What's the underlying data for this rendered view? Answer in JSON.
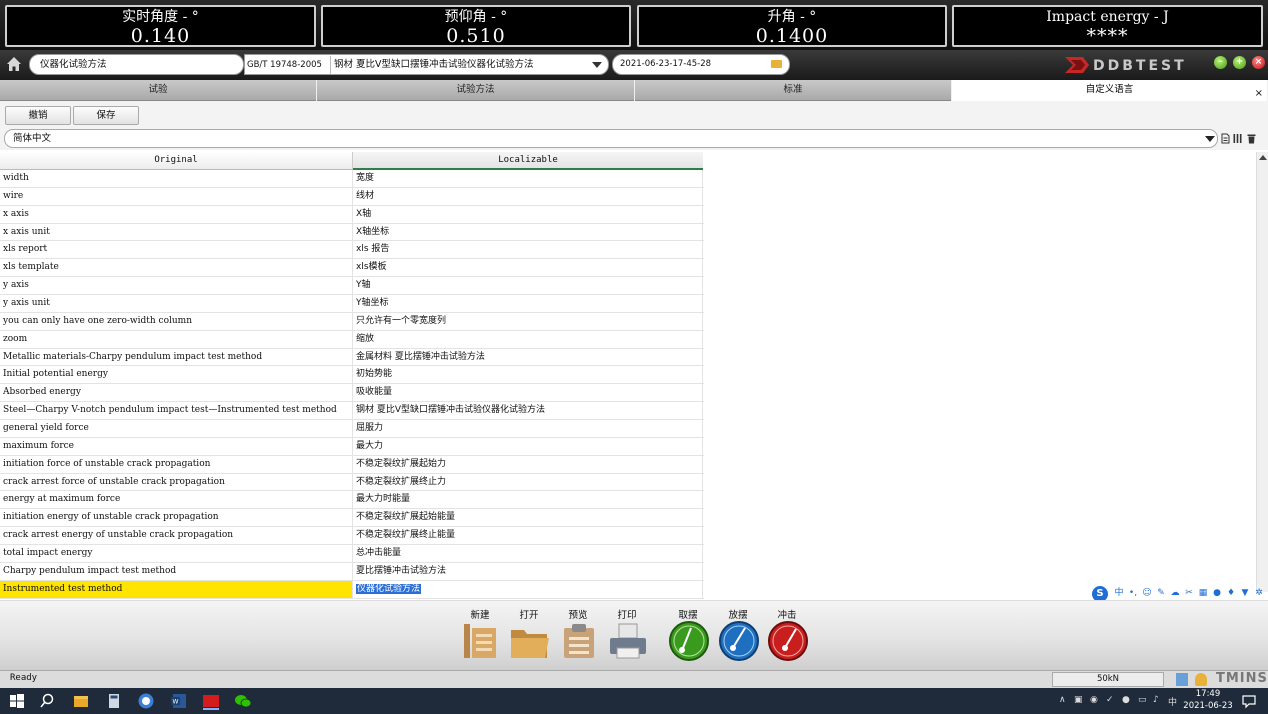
{
  "readouts": [
    {
      "label": "实时角度 - °",
      "value": "0.140"
    },
    {
      "label": "预仰角 - °",
      "value": "0.510"
    },
    {
      "label": "升角 - °",
      "value": "0.1400"
    },
    {
      "label": "Impact energy - J",
      "value": "****"
    }
  ],
  "toolbar": {
    "method_name": "仪器化试验方法",
    "standard_code": "GB/T 19748-2005",
    "standard_name": "钢材 夏比V型缺口摆锤冲击试验仪器化试验方法",
    "date": "2021-06-23-17-45-28",
    "logo_text": "DDBTEST",
    "window_buttons": [
      "–",
      "+",
      "×"
    ]
  },
  "tabs": [
    {
      "label": "试验",
      "active": false
    },
    {
      "label": "试验方法",
      "active": false
    },
    {
      "label": "标准",
      "active": false
    },
    {
      "label": "自定义语言",
      "active": true
    }
  ],
  "tab_close": "×",
  "actions": {
    "undo": "撤销",
    "save": "保存"
  },
  "language": {
    "selected": "简体中文"
  },
  "table": {
    "headers": {
      "original": "Original",
      "localizable": "Localizable"
    },
    "rows": [
      {
        "original": "width",
        "localizable": "宽度"
      },
      {
        "original": "wire",
        "localizable": "线材"
      },
      {
        "original": "x axis",
        "localizable": "X轴"
      },
      {
        "original": "x axis unit",
        "localizable": "X轴坐标"
      },
      {
        "original": "xls report",
        "localizable": "xls 报告"
      },
      {
        "original": "xls template",
        "localizable": "xls模板"
      },
      {
        "original": "y axis",
        "localizable": "Y轴"
      },
      {
        "original": "y axis unit",
        "localizable": "Y轴坐标"
      },
      {
        "original": "you can only have one zero-width column",
        "localizable": "只允许有一个零宽度列"
      },
      {
        "original": "zoom",
        "localizable": "缩放"
      },
      {
        "original": "Metallic materials-Charpy pendulum impact test method",
        "localizable": "金属材料 夏比摆锤冲击试验方法"
      },
      {
        "original": "Initial potential energy",
        "localizable": "初始势能"
      },
      {
        "original": "Absorbed energy",
        "localizable": "吸收能量"
      },
      {
        "original": "Steel—Charpy V-notch pendulum impact test—Instrumented test method",
        "localizable": "钢材 夏比V型缺口摆锤冲击试验仪器化试验方法"
      },
      {
        "original": "general yield force",
        "localizable": "屈服力"
      },
      {
        "original": "maximum force",
        "localizable": "最大力"
      },
      {
        "original": "initiation force of unstable crack propagation",
        "localizable": "不稳定裂纹扩展起始力"
      },
      {
        "original": "crack arrest force of unstable crack propagation",
        "localizable": "不稳定裂纹扩展终止力"
      },
      {
        "original": "energy at maximum force",
        "localizable": "最大力时能量"
      },
      {
        "original": "initiation energy of unstable crack propagation",
        "localizable": "不稳定裂纹扩展起始能量"
      },
      {
        "original": "crack arrest energy of unstable crack propagation",
        "localizable": "不稳定裂纹扩展终止能量"
      },
      {
        "original": "total impact energy",
        "localizable": "总冲击能量"
      },
      {
        "original": "Charpy pendulum impact test method",
        "localizable": "夏比摆锤冲击试验方法"
      },
      {
        "original": "Instrumented test method",
        "localizable": "仪器化试验方法",
        "selected": true
      }
    ]
  },
  "bottom_toolbar": [
    {
      "label": "新建",
      "icon": "new-document-icon"
    },
    {
      "label": "打开",
      "icon": "open-folder-icon"
    },
    {
      "label": "预览",
      "icon": "preview-clipboard-icon"
    },
    {
      "label": "打印",
      "icon": "printer-icon"
    },
    {
      "label": "取摆",
      "icon": "raise-pendulum-icon",
      "color": "#3a9a1e"
    },
    {
      "label": "放摆",
      "icon": "release-pendulum-icon",
      "color": "#1e6fc0"
    },
    {
      "label": "冲击",
      "icon": "impact-icon",
      "color": "#c81e1e"
    }
  ],
  "status": {
    "text": "Ready",
    "force": "50kN",
    "brand": "TMINS"
  },
  "taskbar": {
    "time": "17:49",
    "date": "2021-06-23",
    "ime_mode": "中"
  },
  "colors": {
    "selection_yellow": "#ffe400",
    "selection_blue": "#2b6fd6",
    "header_underline": "#2f7d4a"
  }
}
